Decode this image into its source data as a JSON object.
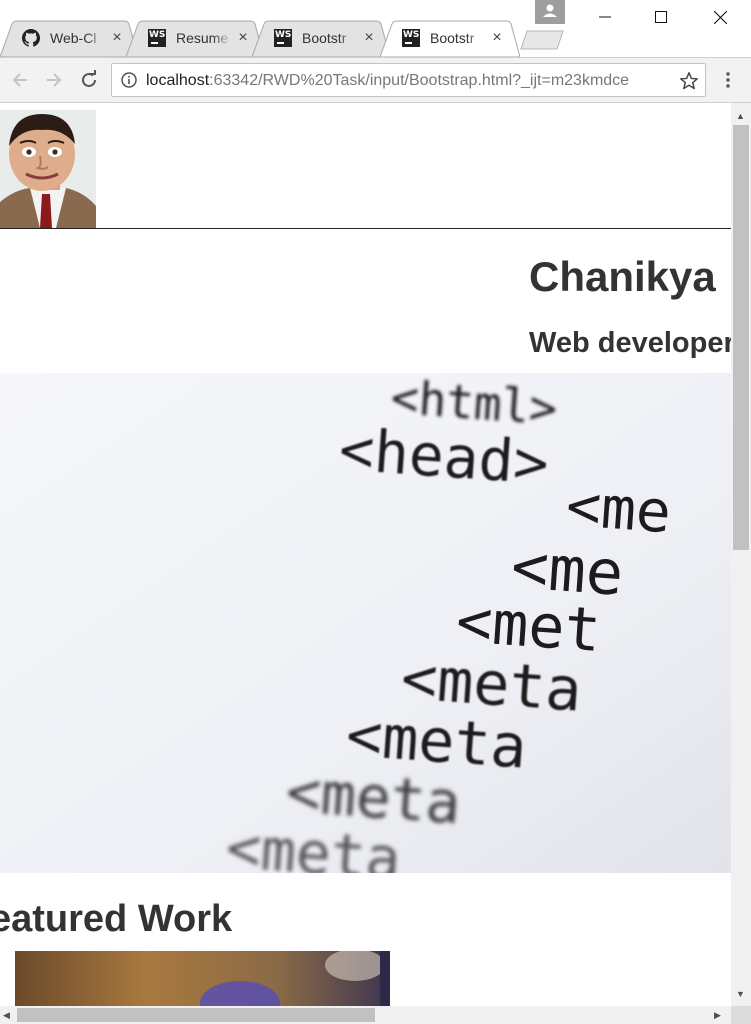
{
  "browser": {
    "tabs": [
      {
        "title": "Web-Cl",
        "icon": "github-icon",
        "active": false
      },
      {
        "title": "Resume",
        "icon": "webstorm-icon",
        "active": false
      },
      {
        "title": "Bootstr",
        "icon": "webstorm-icon",
        "active": false
      },
      {
        "title": "Bootstr",
        "icon": "webstorm-icon",
        "active": true
      }
    ],
    "tab_close_glyph": "×",
    "webstorm_badge": "WS",
    "url_host": "localhost",
    "url_path": ":63342/RWD%20Task/input/Bootstrap.html?_ijt=m23kmdce"
  },
  "page": {
    "name": "Chanikya",
    "role": "Web developer",
    "featured_heading": "eatured Work",
    "hero_code_lines": [
      "<html>",
      "<head>",
      "<me",
      "<me",
      "<met",
      "<meta",
      "<meta",
      "<meta",
      "<meta"
    ]
  },
  "colors": {
    "text": "#333333",
    "tab_active": "#ffffff",
    "tab_inactive": "#e3e3e3",
    "toolbar": "#f2f2f2",
    "scroll_thumb": "#c1c1c1"
  }
}
